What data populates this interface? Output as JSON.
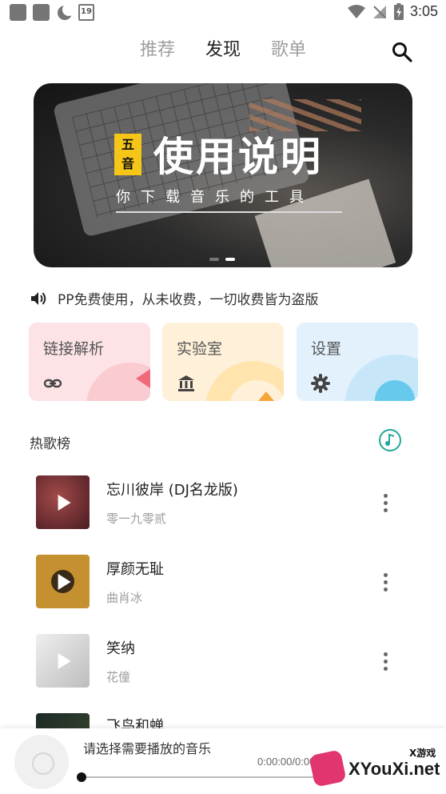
{
  "status_bar": {
    "time": "3:05",
    "calendar_day": "19"
  },
  "tabs": [
    {
      "label": "推荐",
      "active": false
    },
    {
      "label": "发现",
      "active": true
    },
    {
      "label": "歌单",
      "active": false
    }
  ],
  "banner": {
    "badge_line1": "五",
    "badge_line2": "音",
    "title": "使用说明",
    "subtitle": "你下载音乐的工具",
    "page_count": 2,
    "current_page": 2
  },
  "notice": {
    "icon": "speaker-icon",
    "text": "PP免费使用，从未收费，一切收费皆为盗版"
  },
  "cards": [
    {
      "title": "链接解析",
      "icon": "link-icon",
      "color": "#fde3e6",
      "accent": "#f06a7a"
    },
    {
      "title": "实验室",
      "icon": "bank-icon",
      "color": "#fff1d9",
      "accent": "#f4a63a"
    },
    {
      "title": "设置",
      "icon": "gear-icon",
      "color": "#e2f1fb",
      "accent": "#4fc3e8"
    }
  ],
  "hot": {
    "title": "热歌榜",
    "songs": [
      {
        "title": "忘川彼岸 (DJ名龙版)",
        "artist": "零一九零贰",
        "cover_color": "#6b2a2e"
      },
      {
        "title": "厚颜无耻",
        "artist": "曲肖冰",
        "cover_color": "#b8862c"
      },
      {
        "title": "笑纳",
        "artist": "花僮",
        "cover_color": "#dcdcdc"
      },
      {
        "title": "飞鸟和蝉",
        "artist": "",
        "cover_color": "#1d2a26"
      }
    ]
  },
  "player": {
    "placeholder": "请选择需要播放的音乐",
    "time": "0:00:00/0:00",
    "progress": 0
  },
  "watermark": {
    "text": "XYouXi.net",
    "top": "X游戏"
  }
}
